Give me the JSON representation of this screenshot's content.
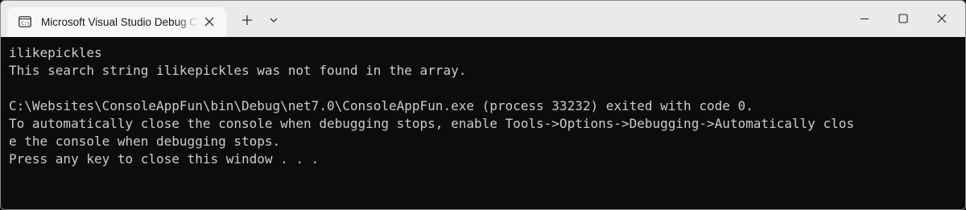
{
  "window": {
    "tab_title": "Microsoft Visual Studio Debug Console",
    "tab_icon": "console-app-icon",
    "icons": {
      "close_tab": "close-icon",
      "new_tab": "plus-icon",
      "tab_menu": "chevron-down-icon",
      "minimize": "minimize-icon",
      "maximize": "maximize-icon",
      "close_window": "close-icon"
    }
  },
  "console": {
    "lines": [
      "ilikepickles",
      "This search string ilikepickles was not found in the array.",
      "",
      "C:\\Websites\\ConsoleAppFun\\bin\\Debug\\net7.0\\ConsoleAppFun.exe (process 33232) exited with code 0.",
      "To automatically close the console when debugging stops, enable Tools->Options->Debugging->Automatically clos",
      "e the console when debugging stops.",
      "Press any key to close this window . . ."
    ],
    "text_color": "#cccccc",
    "background_color": "#0c0c0c"
  }
}
